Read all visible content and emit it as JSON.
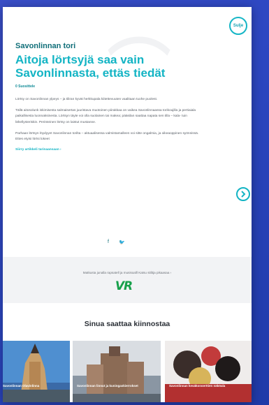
{
  "close_button": {
    "label": "Sulje"
  },
  "article": {
    "kicker": "Savonlinnan tori",
    "headline": "Aitoja lörtsyjä saa vain Savonlinnasta, ettäs tiedät",
    "share_label": "0 Suosittele",
    "paragraphs": [
      "Lörtsy on Savonlinnan ylpeys – ja tiliran kyvät herkkupala kiitettevuuten vaalitaan tuohe puolest.",
      "Tällä aitosolunk iskimisesta salmaisertas juuristava muotoinen piirakkaa on vaikea Savonlinnaassa torikoujilla ja pertiaiala paikallisesta luonnaksinesta. Lörtsyn täyte voi olla suolainen tai makea; pääsilan saattaa napata sen tilla – kala- tuin lähellysteriskin. Perinteinen lörtsy on laistut mustanne.",
      "Parhaan lörtsyn löydyyet Savonlinnan torilta – aktuaalisessa valmistamalleen voi sitte ongalmia, ja oikeaoppinen syönnissä. Ettes etyisi lörtsi lokeet"
    ],
    "read_more": "Siirry artikkeli tarinaansaan ›"
  },
  "social": {
    "facebook": "f",
    "twitter": "🐦"
  },
  "sponsor": {
    "text": "Matkusta junalla rapsatell ja musisoalll Katsu sitlitja pikaasaa ›",
    "logo": "VR"
  },
  "recommendations": {
    "title": "Sinua saattaa kiinnostaa",
    "cards": [
      {
        "label": "Savonlinnan Olavinlinna"
      },
      {
        "label": "Savonlinnan linnut ja kuningaskierrokset"
      },
      {
        "label": "Savonlinnan kesäkonserttien näköala"
      }
    ]
  },
  "colors": {
    "accent": "#13b4c4",
    "accent_dark": "#0f6e78",
    "vr_green": "#17a04a",
    "background": "#2d47c2"
  },
  "icons": {
    "close": "close-icon",
    "next": "chevron-right-icon",
    "facebook": "facebook-icon",
    "twitter": "twitter-icon"
  }
}
